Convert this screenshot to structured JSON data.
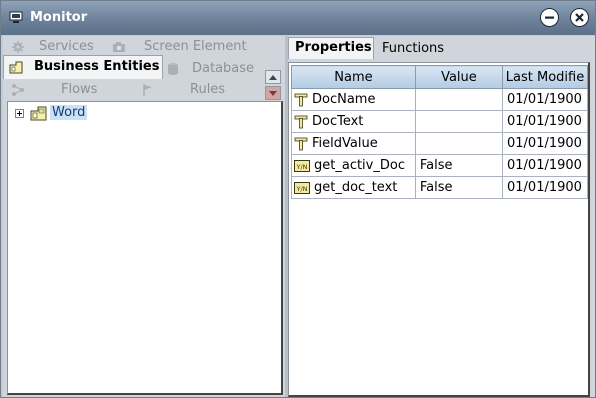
{
  "window": {
    "title": "Monitor"
  },
  "nav": {
    "row1": [
      {
        "label": "Services",
        "icon": "gear-icon"
      },
      {
        "label": "Screen Element",
        "icon": "camera-icon"
      }
    ],
    "row2": [
      {
        "label": "Business Entities",
        "icon": "folder-entity-icon",
        "active": true
      },
      {
        "label": "Database",
        "icon": "database-icon"
      }
    ],
    "row3": [
      {
        "label": "Flows",
        "icon": "flow-icon"
      },
      {
        "label": "Rules",
        "icon": "flag-icon"
      }
    ]
  },
  "tree": {
    "nodes": [
      {
        "label": "Word",
        "selected": true,
        "expanded": false
      }
    ]
  },
  "tabs": [
    {
      "label": "Properties",
      "active": true
    },
    {
      "label": "Functions",
      "active": false
    }
  ],
  "table": {
    "columns": [
      "Name",
      "Value",
      "Last Modifie"
    ],
    "rows": [
      {
        "type": "text-property",
        "name": "DocName",
        "value": "",
        "modified": "01/01/1900"
      },
      {
        "type": "text-property",
        "name": "DocText",
        "value": "",
        "modified": "01/01/1900"
      },
      {
        "type": "text-property",
        "name": "FieldValue",
        "value": "",
        "modified": "01/01/1900"
      },
      {
        "type": "boolean-property",
        "name": "get_activ_Doc",
        "value": "False",
        "modified": "01/01/1900"
      },
      {
        "type": "boolean-property",
        "name": "get_doc_text",
        "value": "False",
        "modified": "01/01/1900"
      }
    ]
  },
  "colors": {
    "titlebar": "#6d8299",
    "selection": "#c9e2f7",
    "header": "#b3cbe3"
  }
}
